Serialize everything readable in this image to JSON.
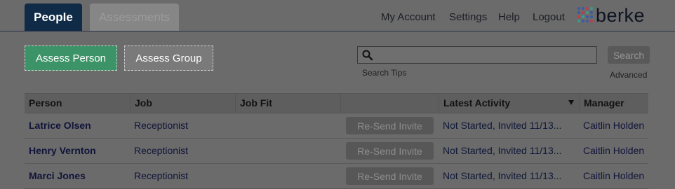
{
  "tabs": [
    {
      "label": "People",
      "active": true
    },
    {
      "label": "Assessments",
      "active": false
    }
  ],
  "nav": {
    "my_account": "My Account",
    "settings": "Settings",
    "help": "Help",
    "logout": "Logout"
  },
  "logo": {
    "text": "berke",
    "dot_colors": [
      "#3b5aa6",
      "#c23b4a",
      "#3a9d8f",
      "#3b5aa6"
    ]
  },
  "actions": {
    "assess_person": "Assess Person",
    "assess_group": "Assess Group"
  },
  "search": {
    "value": "",
    "button": "Search",
    "tips": "Search Tips",
    "advanced": "Advanced"
  },
  "table": {
    "headers": [
      "Person",
      "Job",
      "Job Fit",
      "",
      "Latest Activity",
      "Manager"
    ],
    "sort_column": "Latest Activity",
    "rows": [
      {
        "person": "Latrice Olsen",
        "job": "Receptionist",
        "job_fit": "",
        "action": "Re-Send Invite",
        "activity": "Not Started, Invited 11/13...",
        "manager": "Caitlin Holden"
      },
      {
        "person": "Henry Vernton",
        "job": "Receptionist",
        "job_fit": "",
        "action": "Re-Send Invite",
        "activity": "Not Started, Invited 11/13...",
        "manager": "Caitlin Holden"
      },
      {
        "person": "Marci Jones",
        "job": "Receptionist",
        "job_fit": "",
        "action": "Re-Send Invite",
        "activity": "Not Started, Invited 11/13...",
        "manager": "Caitlin Holden"
      }
    ]
  },
  "colors": {
    "active_tab": "#0f2b47",
    "primary_button": "#3d9368",
    "link_text": "#10143a"
  }
}
